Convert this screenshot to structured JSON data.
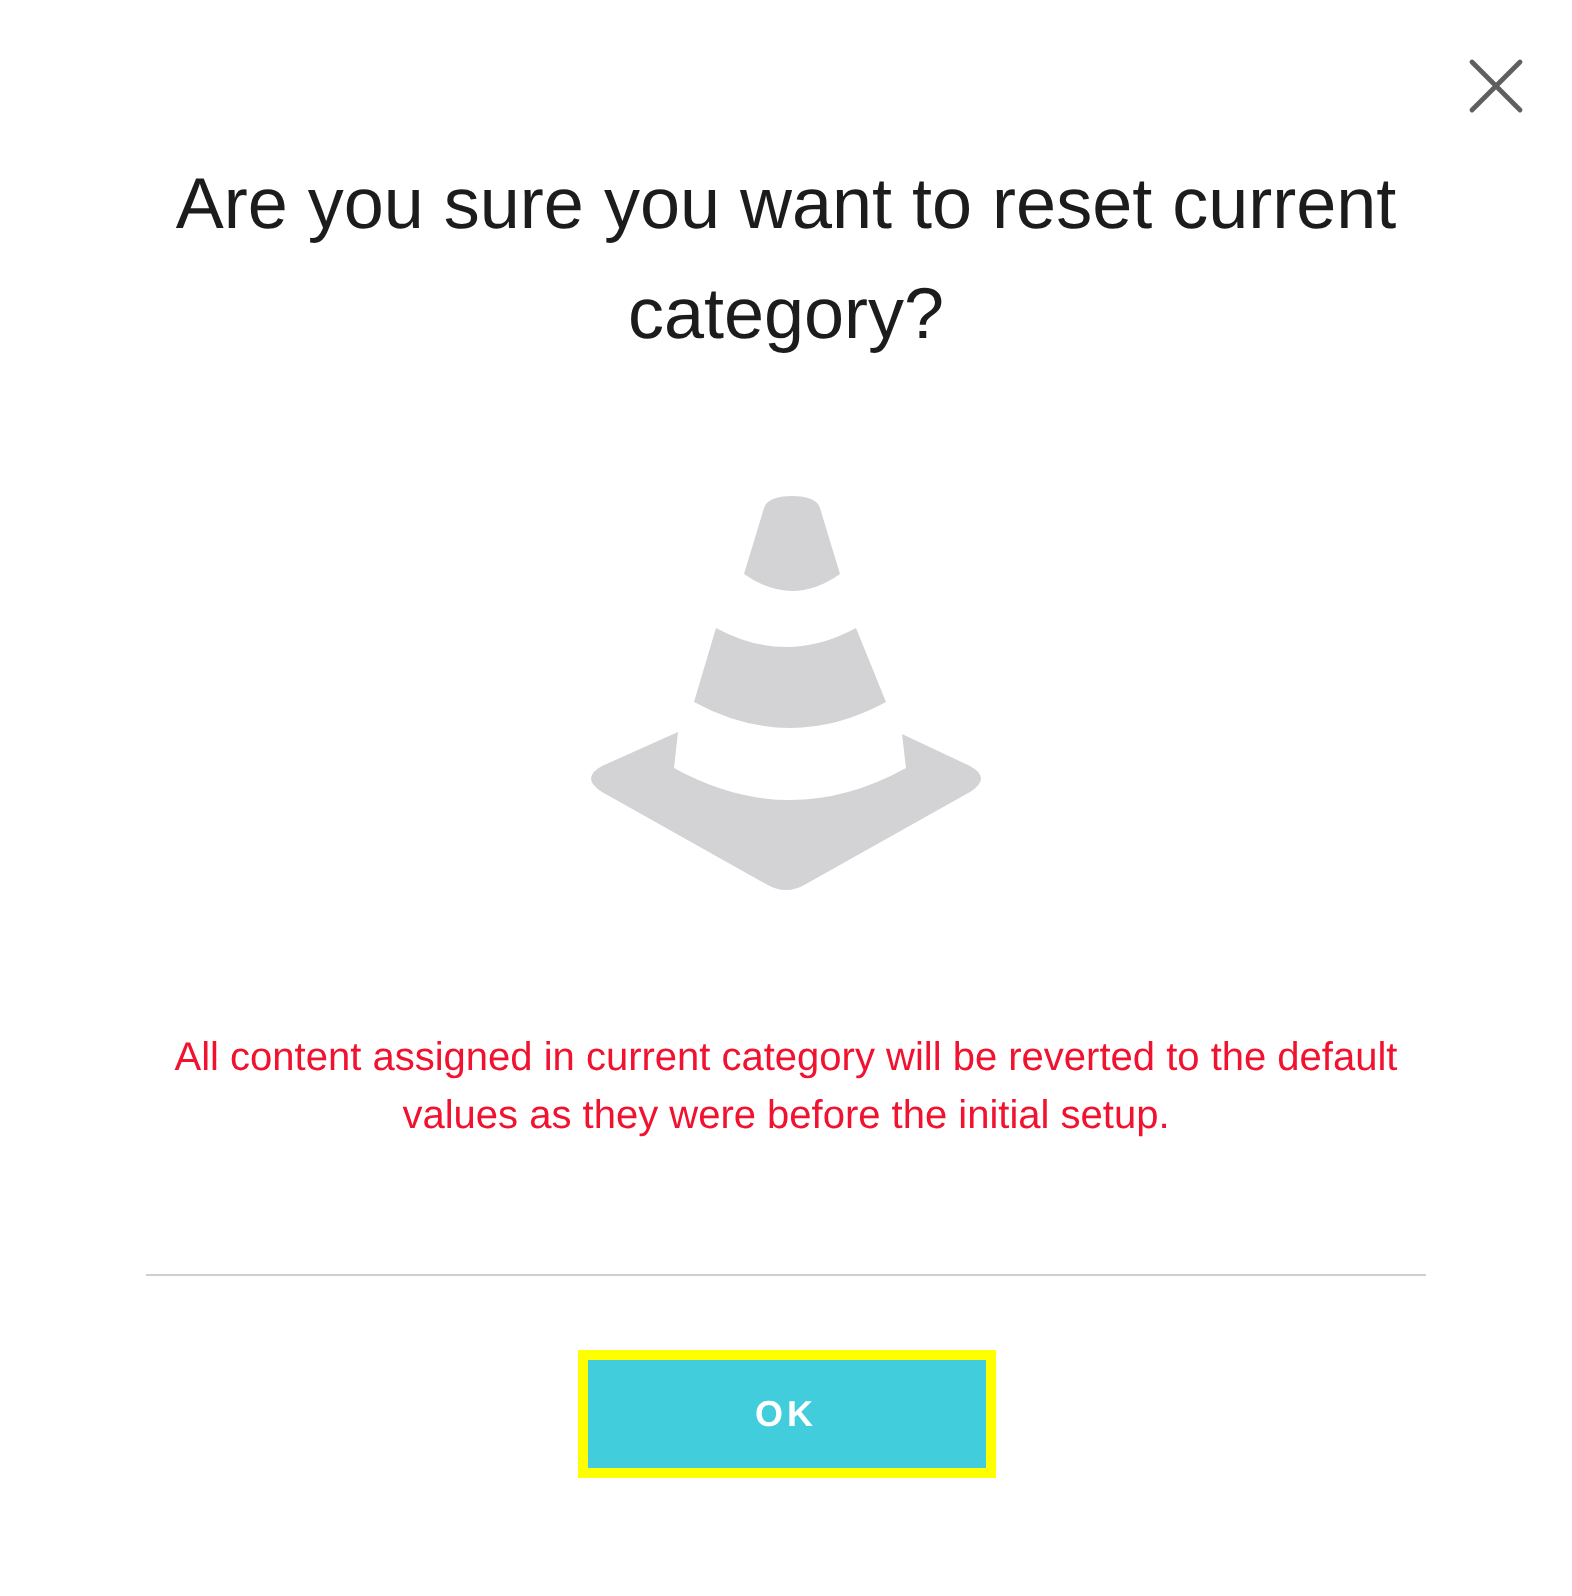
{
  "dialog": {
    "title": "Are you sure you want to reset current category?",
    "message": "All content assigned in current category will be reverted to the default values as they were before the initial setup.",
    "buttons": [
      {
        "label": "OK",
        "focused": true
      }
    ]
  }
}
